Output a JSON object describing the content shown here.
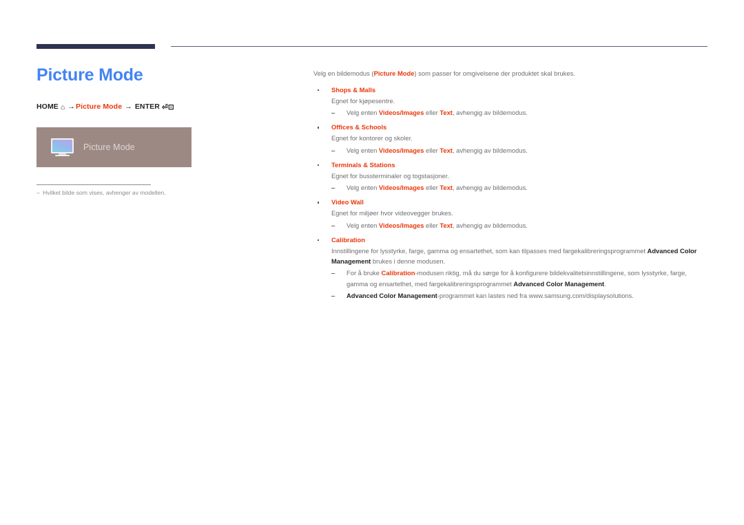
{
  "document": {
    "title": "Picture Mode",
    "accent_color": "#e8380d",
    "title_color": "#4285f4",
    "rule_color": "#2e3350"
  },
  "left": {
    "title": "Picture Mode",
    "breadcrumb": {
      "home_label": "HOME",
      "home_icon": "home-icon",
      "arrow": "→",
      "middle_label": "Picture Mode",
      "enter_label": "ENTER",
      "enter_icon": "enter-key-icon"
    },
    "screenshot": {
      "icon": "monitor-icon",
      "label": "Picture Mode"
    },
    "note": {
      "dash": "‒",
      "text": "Hvilket bilde som vises, avhenger av modellen."
    }
  },
  "right": {
    "intro": {
      "before": "Velg en bildemodus (",
      "term": "Picture Mode",
      "after": ") som passer for omgivelsene der produktet skal brukes."
    },
    "choice_line": {
      "lead": "Velg enten ",
      "term1": "Videos/Images",
      "mid": " eller ",
      "term2": "Text",
      "tail": ", avhengig av bildemodus."
    },
    "items": [
      {
        "name": "Shops & Malls",
        "desc": "Egnet for kjøpesentre."
      },
      {
        "name": "Offices & Schools",
        "desc": "Egnet for kontorer og skoler."
      },
      {
        "name": "Terminals & Stations",
        "desc": "Egnet for bussterminaler og togstasjoner."
      },
      {
        "name": "Video Wall",
        "desc": "Egnet for miljøer hvor videovegger brukes."
      }
    ],
    "calibration": {
      "name": "Calibration",
      "desc_part1": "Innstillingene for lysstyrke, farge, gamma og ensartethet, som kan tilpasses med fargekalibreringsprogrammet ",
      "desc_bold1": "Advanced Color Management",
      "desc_part2": " brukes i denne modusen.",
      "sub1_part1": "For å bruke ",
      "sub1_term": "Calibration",
      "sub1_part2": "-modusen riktig, må du sørge for å konfigurere bildekvalitetsinnstillingene, som lysstyrke, farge, gamma og ensartethet, med fargekalibreringsprogrammet ",
      "sub1_bold": "Advanced Color Management",
      "sub1_part3": ".",
      "sub2_bold": "Advanced Color Management",
      "sub2_text": "-programmet kan lastes ned fra www.samsung.com/displaysolutions."
    }
  }
}
